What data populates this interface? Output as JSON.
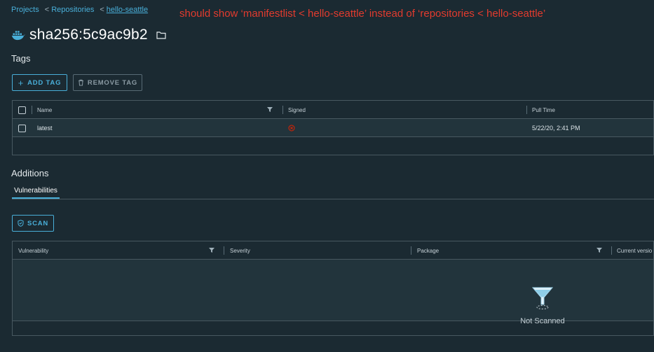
{
  "breadcrumb": {
    "items": [
      "Projects",
      "Repositories",
      "hello-seattle"
    ],
    "separator": "<"
  },
  "annotation": "should show ‘manifestlist < hello-seattle’ instead of ‘repositories < hello-seattle’",
  "page": {
    "title": "sha256:5c9ac9b2"
  },
  "tags_section": {
    "title": "Tags",
    "add_tag_label": "ADD TAG",
    "remove_tag_label": "REMOVE TAG",
    "columns": [
      "Name",
      "Signed",
      "Pull Time"
    ],
    "rows": [
      {
        "name": "latest",
        "signed": "not-signed-icon",
        "pull_time": "5/22/20, 2:41 PM"
      }
    ]
  },
  "additions_section": {
    "title": "Additions",
    "tabs": [
      "Vulnerabilities"
    ],
    "scan_label": "SCAN",
    "columns": [
      "Vulnerability",
      "Severity",
      "Package",
      "Current versio"
    ],
    "empty_text": "Not Scanned"
  },
  "colors": {
    "background": "#1b2a32",
    "accent": "#49afd9",
    "annotation": "#e23b2e",
    "error": "#e12200"
  }
}
